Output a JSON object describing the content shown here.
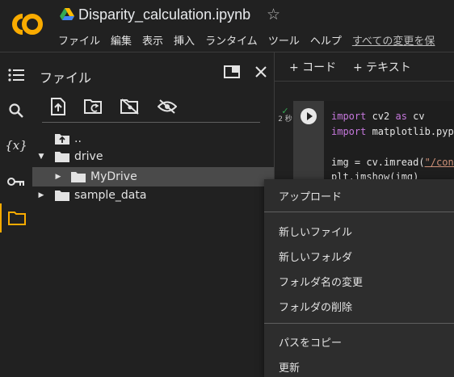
{
  "header": {
    "logo_text": "CO",
    "logo_icon": "colab-logo",
    "drive_icon": "google-drive-icon",
    "title": "Disparity_calculation.ipynb",
    "star_icon": "star-outline-icon"
  },
  "menu": [
    "ファイル",
    "編集",
    "表示",
    "挿入",
    "ランタイム",
    "ツール",
    "ヘルプ",
    "すべての変更を保"
  ],
  "rail": {
    "icons": [
      "toc-icon",
      "search-icon",
      "variables-icon",
      "key-icon",
      "folder-icon"
    ],
    "variables_label": "{x}"
  },
  "files_panel": {
    "title": "ファイル",
    "tools": [
      "upload-icon",
      "new-folder-refresh-icon",
      "hide-drive-icon",
      "hide-hidden-icon"
    ],
    "tree": [
      {
        "label": "..",
        "icon": "folder-up-icon"
      },
      {
        "label": "drive",
        "expanded": true
      },
      {
        "label": "MyDrive",
        "expanded": false,
        "selected": true
      },
      {
        "label": "sample_data",
        "expanded": false
      }
    ]
  },
  "notebook": {
    "add_code": "+ コード",
    "add_text": "+ テキスト",
    "cell_status_check": "✓",
    "cell_status_time": "2 秒",
    "code_lines": [
      [
        "import",
        " cv2 ",
        "as",
        " cv"
      ],
      [
        "import",
        " matplotlib.pyplo"
      ],
      [
        "img = cv.imread(",
        "\"/cont"
      ],
      [
        "plt.imshow(img)"
      ]
    ]
  },
  "context_menu": {
    "items": [
      "アップロード",
      "新しいファイル",
      "新しいフォルダ",
      "フォルダ名の変更",
      "フォルダの削除",
      "パスをコピー",
      "更新"
    ]
  },
  "colors": {
    "accent": "#f9ab00",
    "background": "#212121",
    "selected_row": "#4a4a4a",
    "menu_bg": "#2d2d2d"
  }
}
